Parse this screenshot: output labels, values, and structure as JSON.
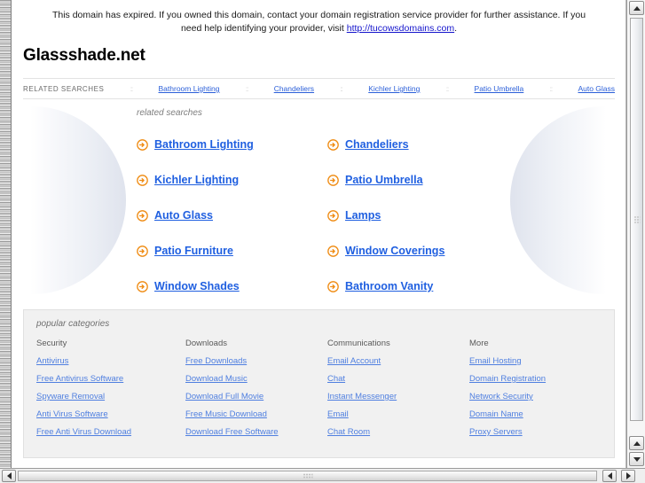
{
  "banner": {
    "text_before": "This domain has expired. If you owned this domain, contact your domain registration service provider for further assistance. If you need help identifying your provider, visit ",
    "link_text": "http://tucowsdomains.com",
    "text_after": "."
  },
  "domain_title": "Glassshade.net",
  "nav": {
    "label": "RELATED SEARCHES",
    "separator": "::",
    "links": [
      "Bathroom Lighting",
      "Chandeliers",
      "Kichler Lighting",
      "Patio Umbrella",
      "Auto Glass"
    ]
  },
  "related_searches": {
    "heading": "related searches",
    "arrow_icon": "arrow-circle-right-icon",
    "items": [
      "Bathroom Lighting",
      "Chandeliers",
      "Kichler Lighting",
      "Patio Umbrella",
      "Auto Glass",
      "Lamps",
      "Patio Furniture",
      "Window Coverings",
      "Window Shades",
      "Bathroom Vanity"
    ]
  },
  "popular_categories": {
    "heading": "popular categories",
    "columns": [
      {
        "title": "Security",
        "links": [
          "Antivirus",
          "Free Antivirus Software",
          "Spyware Removal",
          "Anti Virus Software",
          "Free Anti Virus Download"
        ]
      },
      {
        "title": "Downloads",
        "links": [
          "Free Downloads",
          "Download Music",
          "Download Full Movie",
          "Free Music Download",
          "Download Free Software"
        ]
      },
      {
        "title": "Communications",
        "links": [
          "Email Account",
          "Chat",
          "Instant Messenger",
          "Email",
          "Chat Room"
        ]
      },
      {
        "title": "More",
        "links": [
          "Email Hosting",
          "Domain Registration",
          "Network Security",
          "Domain Name",
          "Proxy Servers"
        ]
      }
    ]
  },
  "colors": {
    "link_blue": "#1f5fe0",
    "nav_link_blue": "#2b5fd9",
    "category_link_blue": "#4f7fe0",
    "arrow_orange": "#ef8b12",
    "category_bg": "#f1f1f1"
  },
  "scrollbars": {
    "vertical_up_icon": "triangle-up-icon",
    "vertical_down_icon": "triangle-down-icon",
    "horizontal_left_icon": "triangle-left-icon",
    "horizontal_right_icon": "triangle-right-icon"
  }
}
